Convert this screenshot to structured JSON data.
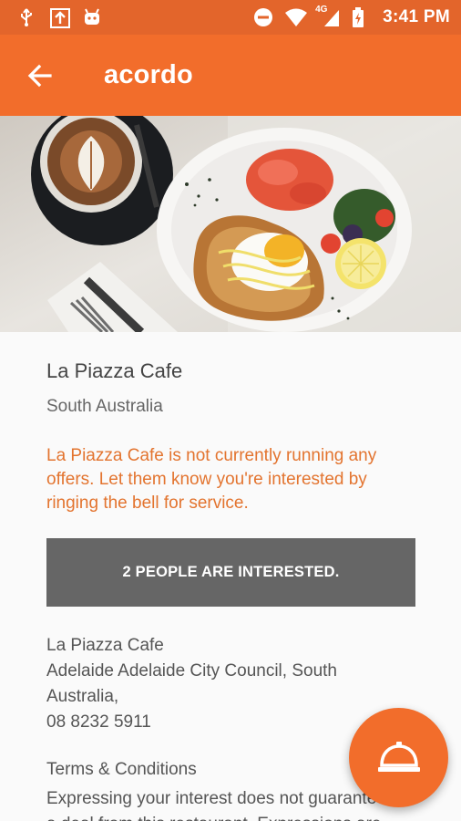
{
  "status_bar": {
    "time": "3:41 PM",
    "network": "4G",
    "icons_left": [
      "usb-icon",
      "download-box-icon",
      "android-icon"
    ],
    "icons_right": [
      "do-not-disturb-icon",
      "wifi-icon",
      "signal-icon",
      "battery-icon"
    ]
  },
  "app_bar": {
    "title": "acordo",
    "back_icon": "arrow-back-icon"
  },
  "hero": {
    "image": "cafe-breakfast-photo"
  },
  "venue": {
    "name": "La Piazza Cafe",
    "region": "South Australia",
    "notice": "La Piazza Cafe is not currently running any offers. Let them know you're interested by ringing the bell for service.",
    "interest_button_label": "2 PEOPLE ARE INTERESTED.",
    "address_name": "La Piazza Cafe",
    "address_line": "Adelaide Adelaide City Council, South Australia,",
    "phone": "08 8232 5911",
    "terms_title": "Terms & Conditions",
    "terms_line1": "Expressing your interest does not guarantee",
    "terms_line2": "a deal from this restaurant. Expressions are"
  },
  "fab": {
    "icon": "service-bell-icon"
  },
  "colors": {
    "status_bar": "#e3652b",
    "app_bar": "#f26d2b",
    "notice_text": "#e3742f",
    "interest_button": "#666666"
  }
}
